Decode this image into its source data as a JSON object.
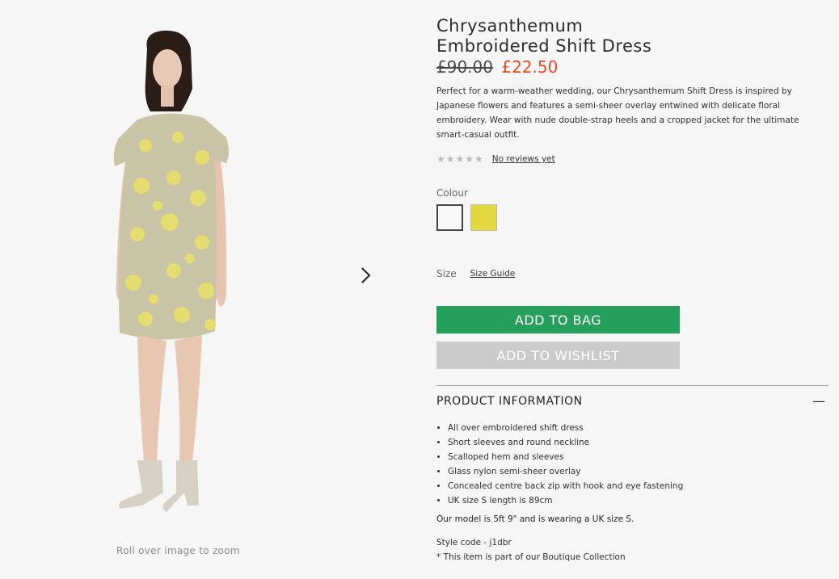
{
  "product": {
    "title_line1": "Chrysanthemum",
    "title_line2": "Embroidered Shift Dress",
    "price_old": "£90.00",
    "price_new": "£22.50",
    "description": "Perfect for a warm-weather wedding, our Chrysanthemum Shift Dress is inspired by Japanese flowers and features a semi-sheer overlay entwined with delicate floral embroidery. Wear with nude double-strap heels and a cropped jacket for the ultimate smart-casual outfit.",
    "stars": "★★★★★",
    "reviews_link": "No reviews yet"
  },
  "gallery": {
    "zoom_hint": "Roll over image to zoom",
    "next_icon": "chevron-right-icon"
  },
  "colour": {
    "label": "Colour",
    "swatches": [
      {
        "name": "white",
        "color": "#f8f8f8"
      },
      {
        "name": "yellow",
        "color": "#e2d73e"
      }
    ]
  },
  "size": {
    "label": "Size",
    "guide_link": "Size Guide"
  },
  "actions": {
    "add_to_bag": "ADD TO BAG",
    "add_to_wishlist": "ADD TO WISHLIST",
    "bag_color": "#24a05c",
    "wishlist_color": "#cbcbcb"
  },
  "product_info": {
    "heading": "PRODUCT INFORMATION",
    "toggle": "—",
    "features": [
      "All over embroidered shift dress",
      "Short sleeves and round neckline",
      "Scalloped hem and sleeves",
      "Glass nylon semi-sheer overlay",
      "Concealed centre back zip with hook and eye fastening",
      "UK size S length is 89cm"
    ],
    "model_note": "Our model is 5ft 9\" and is wearing a UK size S.",
    "style_code": "Style code - j1dbr",
    "boutique_note": "* This item is part of our Boutique Collection"
  }
}
